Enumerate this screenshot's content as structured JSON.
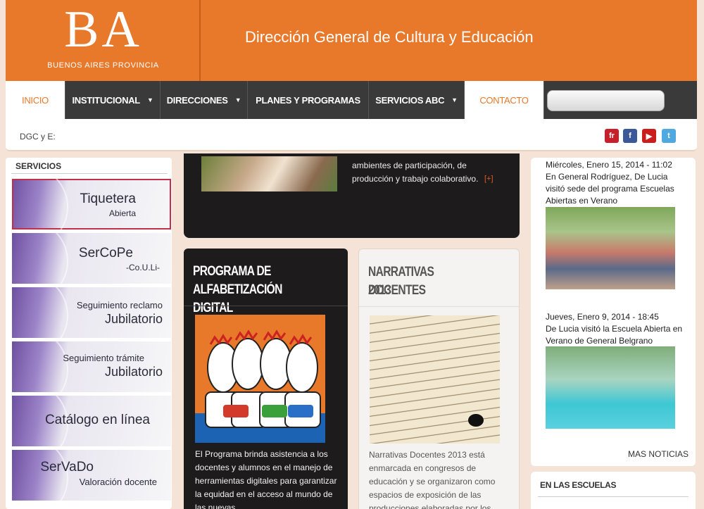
{
  "header": {
    "logo_text": "BA",
    "logo_subtitle": "BUENOS AIRES PROVINCIA",
    "site_title": "Dirección General de Cultura y Educación"
  },
  "nav": {
    "items": [
      {
        "label": "INICIO"
      },
      {
        "label": "INSTITUCIONAL"
      },
      {
        "label": "DIRECCIONES"
      },
      {
        "label": "PLANES Y PROGRAMAS"
      },
      {
        "label": "SERVICIOS ABC"
      },
      {
        "label": "CONTACTO"
      }
    ],
    "caret": "▼",
    "search_placeholder": ""
  },
  "subbar": {
    "label": "DGC y E:",
    "social": [
      {
        "name": "fr",
        "color": "#c8202a"
      },
      {
        "name": "f",
        "color": "#3b5998"
      },
      {
        "name": "▶",
        "color": "#cc1d1d"
      },
      {
        "name": "t",
        "color": "#4fa9e0"
      }
    ]
  },
  "sidebar": {
    "title": "SERVICIOS",
    "items": [
      {
        "line1": "Tiquetera",
        "line2": "Abierta"
      },
      {
        "line1": "SerCoPe",
        "line2": "-Co.U.Li-"
      },
      {
        "line1": "Seguimiento reclamo",
        "line2": "Jubilatorio"
      },
      {
        "line1": "Seguimiento trámite",
        "line2": "Jubilatorio"
      },
      {
        "line1": "Catálogo en línea",
        "line2": ""
      },
      {
        "line1": "SerVaDo",
        "line2": "Valoración docente"
      }
    ]
  },
  "featured": {
    "text_line1": "ambientes de participación, de",
    "text_line2": "producción y trabajo colaborativo.",
    "more": "[+]"
  },
  "panel_alfabetizacion": {
    "title_line1": "PROGRAMA DE",
    "title_line2": "ALFABETIZACIÓN DIGITAL",
    "body": "El Programa brinda asistencia a los docentes y alumnos en el manejo de herramientas digitales para garantizar la equidad en el acceso al mundo de las nuevas"
  },
  "panel_narrativas": {
    "title_line1": "NARRATIVAS DOCENTES",
    "title_line2": "2013",
    "body": "Narrativas Docentes 2013 está enmarcada en congresos de educación y se organizaron como espacios de exposición de las producciones elaboradas por los"
  },
  "news": {
    "items": [
      {
        "date": "Miércoles, Enero 15, 2014 - 11:02",
        "text": "En General Rodríguez, De Lucia visitó sede del programa Escuelas Abiertas en Verano"
      },
      {
        "date": "Jueves, Enero 9, 2014 - 18:45",
        "text": "De Lucia visitó la Escuela Abierta en Verano de General Belgrano"
      }
    ],
    "more": "MAS NOTICIAS"
  },
  "escuelas": {
    "title": "EN LAS ESCUELAS"
  },
  "colors": {
    "accent": "#e8782a",
    "dark": "#3a3a3a"
  }
}
